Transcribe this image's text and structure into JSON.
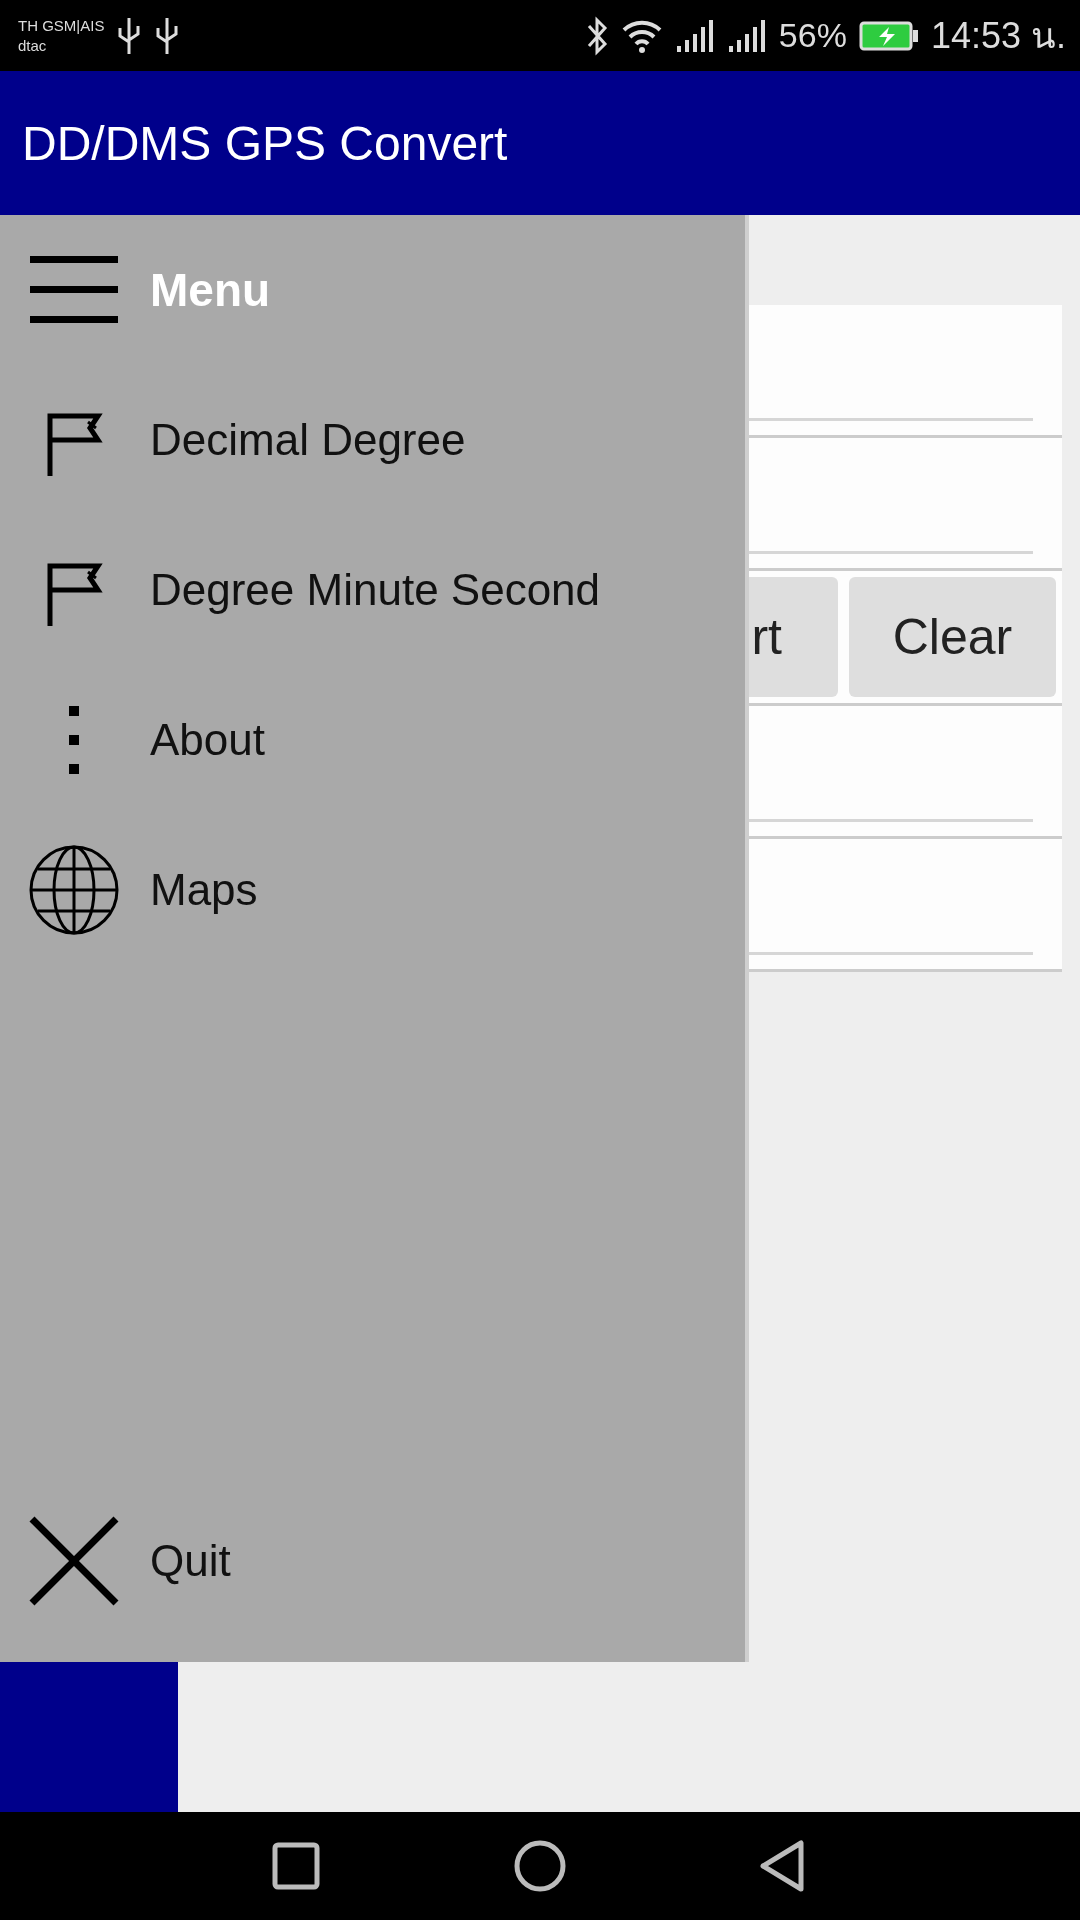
{
  "status_bar": {
    "carrier": "TH GSM|AIS",
    "carrier_2": "dtac",
    "battery": "56%",
    "time": "14:53 น."
  },
  "app_bar": {
    "title": "DD/DMS GPS Convert"
  },
  "drawer": {
    "header": "Menu",
    "items": [
      {
        "label": "Decimal Degree",
        "kind": "flag"
      },
      {
        "label": "Degree Minute Second",
        "kind": "flag"
      },
      {
        "label": "About",
        "kind": "dots"
      },
      {
        "label": "Maps",
        "kind": "globe"
      }
    ],
    "footer": "Quit"
  },
  "content": {
    "buttons": [
      "rt",
      "Clear"
    ]
  }
}
